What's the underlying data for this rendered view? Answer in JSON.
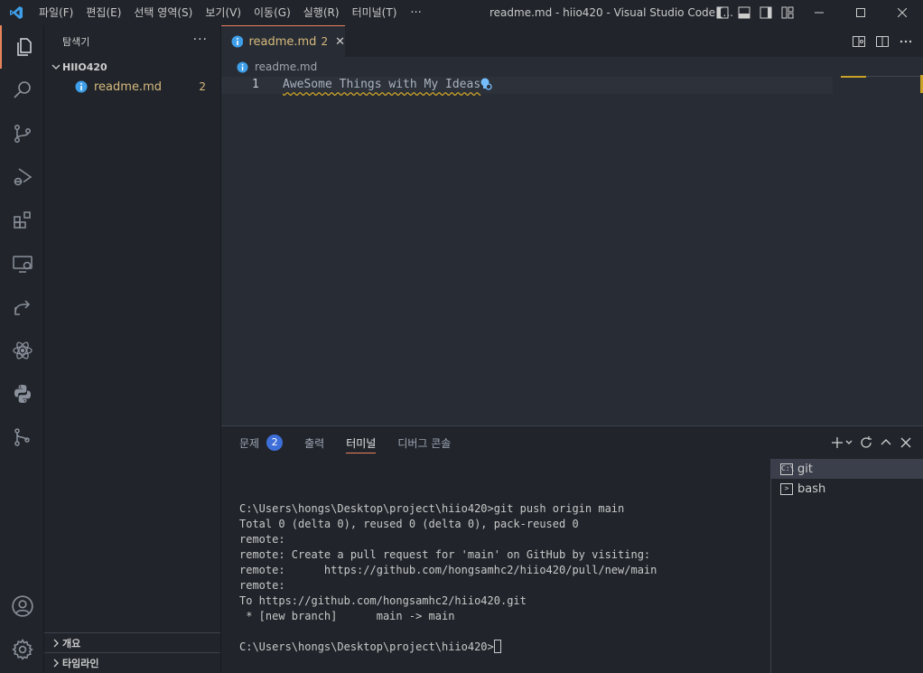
{
  "titlebar": {
    "menu": [
      "파일(F)",
      "편집(E)",
      "선택 영역(S)",
      "보기(V)",
      "이동(G)",
      "실행(R)",
      "터미널(T)"
    ],
    "more": "···",
    "window_title": "readme.md - hiio420 - Visual Studio Code [..."
  },
  "sidebar": {
    "title": "탐색기",
    "more": "···",
    "folder": "HIIO420",
    "file": {
      "name": "readme.md",
      "badge": "2"
    },
    "sections": {
      "outline": "개요",
      "timeline": "타임라인"
    }
  },
  "editor": {
    "tab": {
      "label": "readme.md",
      "num": "2"
    },
    "breadcrumb": "readme.md",
    "line_number": "1",
    "code": "AweSome Things with My Ideas"
  },
  "panel": {
    "tabs": {
      "problems": "문제",
      "problems_count": "2",
      "output": "출력",
      "terminal": "터미널",
      "debug": "디버그 콘솔"
    },
    "terminal_lines": [
      "",
      "C:\\Users\\hongs\\Desktop\\project\\hiio420>git push origin main",
      "Total 0 (delta 0), reused 0 (delta 0), pack-reused 0",
      "remote:",
      "remote: Create a pull request for 'main' on GitHub by visiting:",
      "remote:      https://github.com/hongsamhc2/hiio420/pull/new/main",
      "remote:",
      "To https://github.com/hongsamhc2/hiio420.git",
      " * [new branch]      main -> main",
      ""
    ],
    "prompt": "C:\\Users\\hongs\\Desktop\\project\\hiio420>",
    "terminals": [
      "git",
      "bash"
    ]
  },
  "colors": {
    "accent": "#e8845a",
    "warning": "#d7ba7d",
    "badge": "#3e6fd8"
  }
}
